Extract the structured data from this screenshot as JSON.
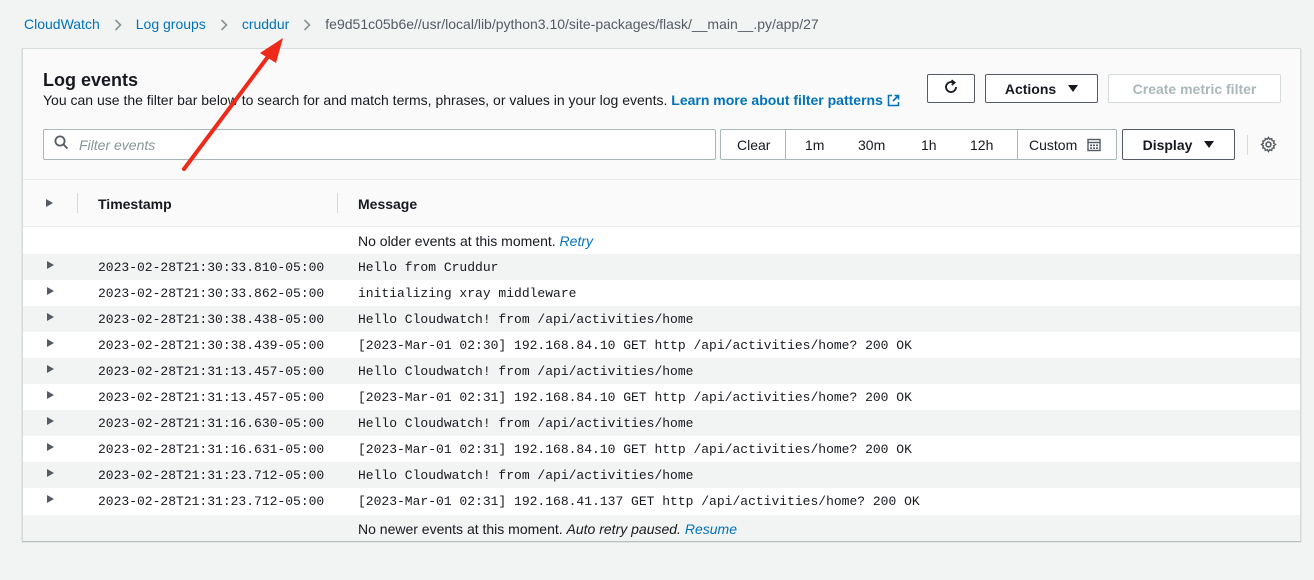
{
  "breadcrumb": {
    "items": [
      "CloudWatch",
      "Log groups",
      "cruddur"
    ],
    "current": "fe9d51c05b6e//usr/local/lib/python3.10/site-packages/flask/__main__.py/app/27"
  },
  "panel": {
    "title": "Log events",
    "description": "You can use the filter bar below to search for and match terms, phrases, or values in your log events.",
    "learn_more": "Learn more about filter patterns"
  },
  "toolbar": {
    "actions_label": "Actions",
    "create_metric_filter_label": "Create metric filter",
    "filter_placeholder": "Filter events",
    "range": {
      "clear": "Clear",
      "r1m": "1m",
      "r30m": "30m",
      "r1h": "1h",
      "r12h": "12h",
      "custom": "Custom"
    },
    "display_label": "Display"
  },
  "table": {
    "headers": {
      "timestamp": "Timestamp",
      "message": "Message"
    },
    "older": {
      "text": "No older events at this moment.",
      "link": "Retry"
    },
    "newer": {
      "text": "No newer events at this moment.",
      "italic": "Auto retry paused.",
      "link": "Resume"
    },
    "rows": [
      {
        "timestamp": "2023-02-28T21:30:33.810-05:00",
        "message": "Hello from Cruddur"
      },
      {
        "timestamp": "2023-02-28T21:30:33.862-05:00",
        "message": "initializing xray middleware"
      },
      {
        "timestamp": "2023-02-28T21:30:38.438-05:00",
        "message": "Hello Cloudwatch! from /api/activities/home"
      },
      {
        "timestamp": "2023-02-28T21:30:38.439-05:00",
        "message": "[2023-Mar-01 02:30] 192.168.84.10 GET http /api/activities/home? 200 OK"
      },
      {
        "timestamp": "2023-02-28T21:31:13.457-05:00",
        "message": "Hello Cloudwatch! from /api/activities/home"
      },
      {
        "timestamp": "2023-02-28T21:31:13.457-05:00",
        "message": "[2023-Mar-01 02:31] 192.168.84.10 GET http /api/activities/home? 200 OK"
      },
      {
        "timestamp": "2023-02-28T21:31:16.630-05:00",
        "message": "Hello Cloudwatch! from /api/activities/home"
      },
      {
        "timestamp": "2023-02-28T21:31:16.631-05:00",
        "message": "[2023-Mar-01 02:31] 192.168.84.10 GET http /api/activities/home? 200 OK"
      },
      {
        "timestamp": "2023-02-28T21:31:23.712-05:00",
        "message": "Hello Cloudwatch! from /api/activities/home"
      },
      {
        "timestamp": "2023-02-28T21:31:23.712-05:00",
        "message": "[2023-Mar-01 02:31] 192.168.41.137 GET http /api/activities/home? 200 OK"
      }
    ]
  },
  "colors": {
    "link": "#0073bb",
    "annotation_arrow": "#ee2a1a"
  },
  "icons": [
    "chevron-right-icon",
    "external-link-icon",
    "refresh-icon",
    "caret-down-icon",
    "search-icon",
    "calendar-icon",
    "gear-icon",
    "expand-triangle-icon"
  ]
}
